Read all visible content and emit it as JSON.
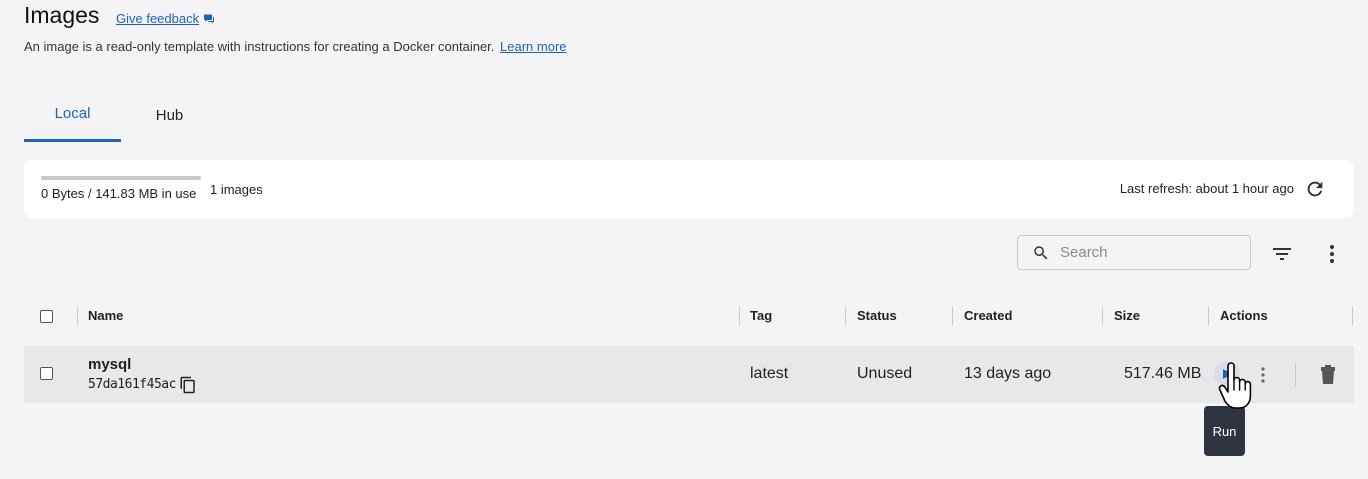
{
  "page": {
    "title": "Images",
    "feedback_label": "Give feedback",
    "description": "An image is a read-only template with instructions for creating a Docker container.",
    "learn_more": "Learn more"
  },
  "tabs": [
    {
      "label": "Local",
      "active": true
    },
    {
      "label": "Hub",
      "active": false
    }
  ],
  "usage": {
    "text": "0 Bytes / 141.83 MB in use",
    "fraction_used": 0,
    "images_count": "1 images",
    "last_refresh": "Last refresh: about 1 hour ago"
  },
  "search": {
    "placeholder": "Search",
    "value": ""
  },
  "table": {
    "columns": [
      "Name",
      "Tag",
      "Status",
      "Created",
      "Size",
      "Actions"
    ],
    "rows": [
      {
        "name": "mysql",
        "id": "57da161f45ac",
        "tag": "latest",
        "status": "Unused",
        "created": "13 days ago",
        "size": "517.46 MB"
      }
    ]
  },
  "tooltip": {
    "text": "Run"
  },
  "colors": {
    "accent": "#1d63b8",
    "row_hover": "#e8e8eb",
    "tooltip_bg": "#2e3440"
  },
  "icons": [
    "feedback-icon",
    "refresh-icon",
    "search-icon",
    "filter-icon",
    "more-vert-icon",
    "copy-icon",
    "play-icon",
    "trash-icon",
    "pointer-hand-icon"
  ]
}
